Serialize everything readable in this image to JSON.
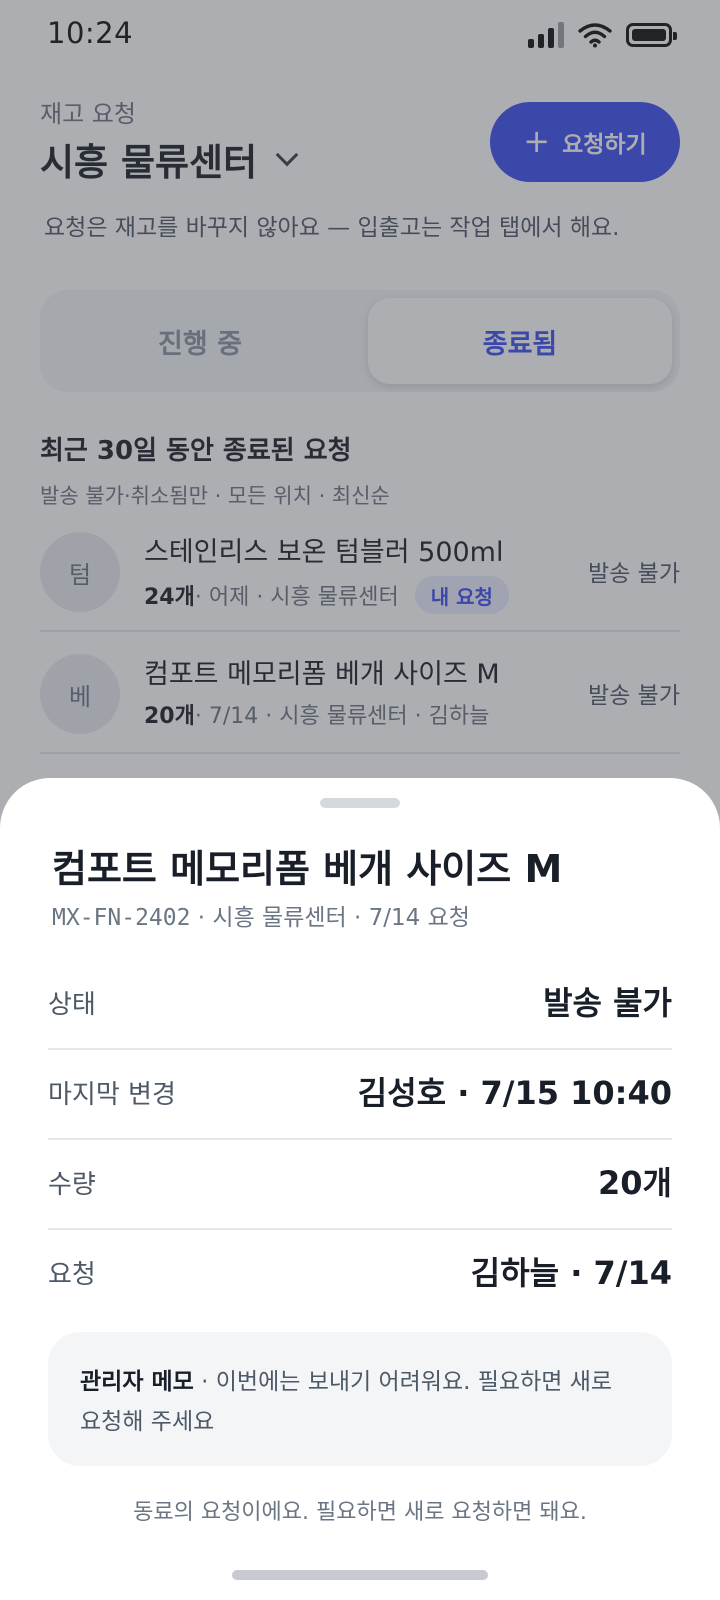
{
  "status_bar": {
    "time": "10:24"
  },
  "header": {
    "eyebrow": "재고 요청",
    "site": "시흥 물류센터",
    "request_button": "요청하기",
    "notice": "요청은 재고를 바꾸지 않아요 — 입출고는 작업 탭에서 해요."
  },
  "tabs": [
    {
      "label": "진행 중",
      "selected": false
    },
    {
      "label": "종료됨",
      "selected": true
    }
  ],
  "list": {
    "title": "최근 30일 동안 종료된 요청",
    "subtitle": "발송 불가·취소됨만 · 모든 위치 · 최신순",
    "items": [
      {
        "avatar": "텀",
        "name": "스테인리스 보온 텀블러 500ml",
        "qty": "24개",
        "meta": " · 어제 · 시흥 물류센터",
        "badge": "내 요청",
        "status": "발송 불가"
      },
      {
        "avatar": "베",
        "name": "컴포트 메모리폼 베개 사이즈 M",
        "qty": "20개",
        "meta": " · 7/14 · 시흥 물류센터 · 김하늘",
        "status": "발송 불가"
      }
    ]
  },
  "sheet": {
    "title": "컴포트 메모리폼 베개 사이즈 M",
    "sku": "MX-FN-2402",
    "sub": " · 시흥 물류센터 · 7/14 요청",
    "details": [
      {
        "label": "상태",
        "value": "발송 불가"
      },
      {
        "label": "마지막 변경",
        "value": "김성호 · 7/15 10:40"
      },
      {
        "label": "수량",
        "value": "20개"
      },
      {
        "label": "요청",
        "value": "김하늘 · 7/14"
      }
    ],
    "memo_label": "관리자 메모",
    "memo_text": " · 이번에는 보내기 어려워요. 필요하면 새로 요청해 주세요",
    "footer": "동료의 요청이에요. 필요하면 새로 요청하면 돼요."
  },
  "colors": {
    "accent": "#3b4ef0",
    "overlay": "rgba(60,63,72,0.42)"
  },
  "icons": [
    "signal-icon",
    "wifi-icon",
    "battery-icon",
    "chevron-down-icon",
    "plus-icon"
  ]
}
